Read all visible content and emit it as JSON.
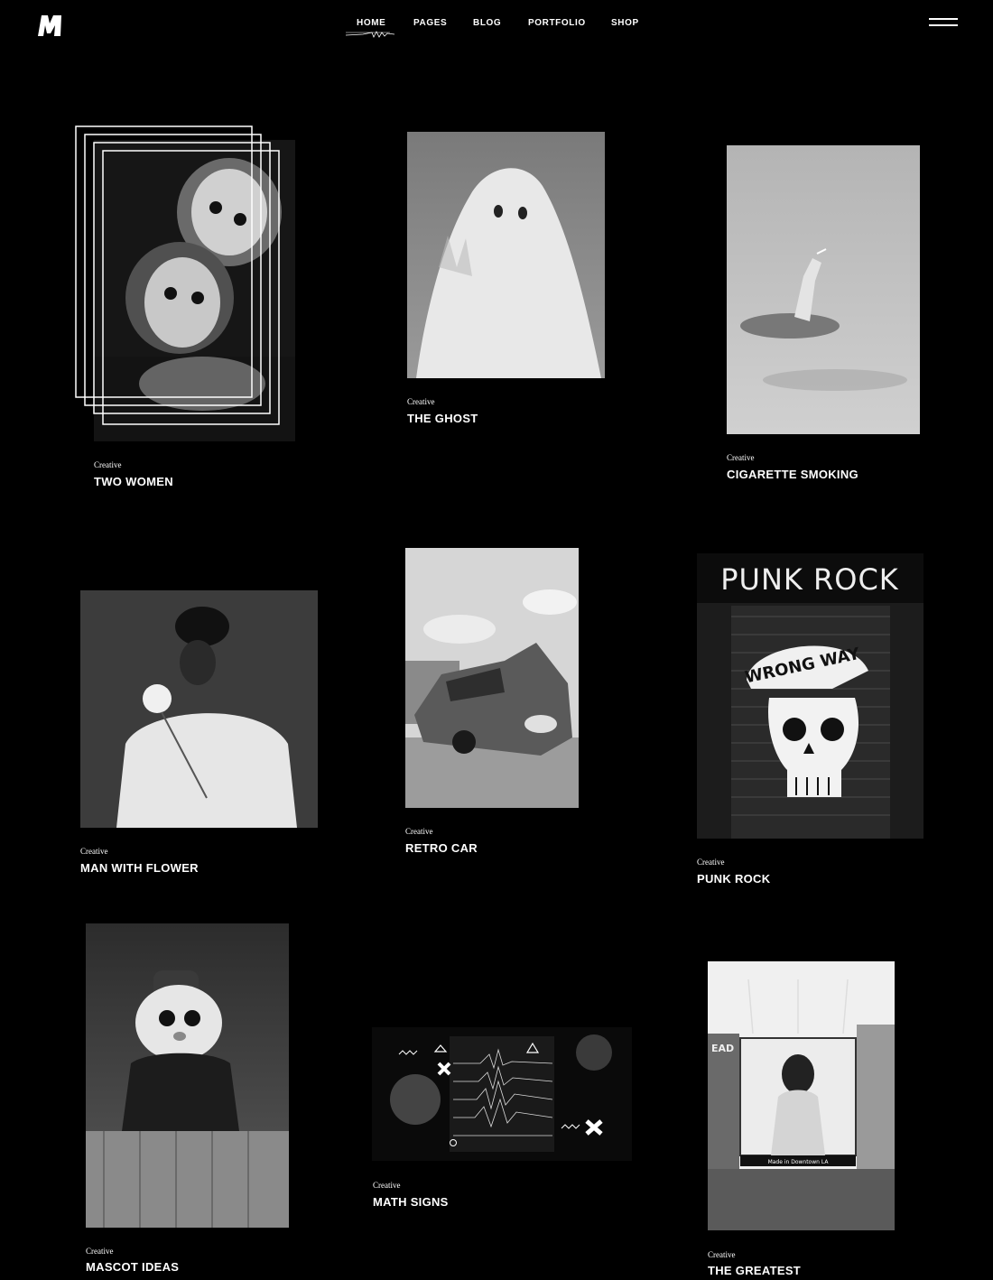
{
  "header": {
    "logo_icon": "m-logo-icon",
    "nav": [
      "HOME",
      "PAGES",
      "BLOG",
      "PORTFOLIO",
      "SHOP"
    ],
    "active_nav": "HOME",
    "menu_icon": "hamburger-icon"
  },
  "portfolio": {
    "items": [
      {
        "category": "Creative",
        "title": "TWO WOMEN"
      },
      {
        "category": "Creative",
        "title": "THE GHOST"
      },
      {
        "category": "Creative",
        "title": "CIGARETTE SMOKING"
      },
      {
        "category": "Creative",
        "title": "MAN WITH FLOWER"
      },
      {
        "category": "Creative",
        "title": "RETRO CAR"
      },
      {
        "category": "Creative",
        "title": "PUNK ROCK"
      },
      {
        "category": "Creative",
        "title": "MASCOT IDEAS"
      },
      {
        "category": "Creative",
        "title": "MATH SIGNS"
      },
      {
        "category": "Creative",
        "title": "THE GREATEST"
      }
    ]
  },
  "image_text": {
    "punk_rock_sign": "PUNK ROCK",
    "punk_rock_cap": "WRONG WAY",
    "billboard_caption": "Made in Downtown LA",
    "billboard_side": "EAD"
  }
}
